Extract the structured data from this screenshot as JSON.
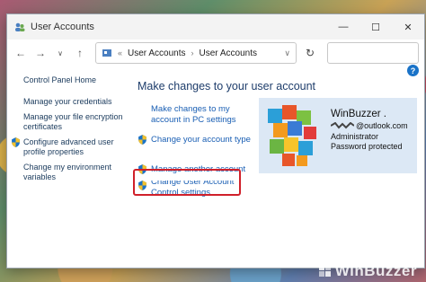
{
  "window": {
    "title": "User Accounts"
  },
  "address": {
    "overflow": "«",
    "crumbs": [
      "User Accounts",
      "User Accounts"
    ]
  },
  "left_nav": {
    "home": "Control Panel Home",
    "items": [
      "Manage your credentials",
      "Manage your file encryption certificates",
      "Configure advanced user profile properties",
      "Change my environment variables"
    ]
  },
  "main": {
    "heading": "Make changes to your user account",
    "tasks": [
      "Make changes to my account in PC settings",
      "Change your account type",
      "Manage another account",
      "Change User Account Control settings"
    ]
  },
  "account": {
    "name": "WinBuzzer .",
    "email": "@outlook.com",
    "role": "Administrator",
    "status": "Password protected"
  },
  "watermark": "WinBuzzer",
  "colors": {
    "highlight": "#d0202a",
    "link": "#1a5fb4",
    "card_bg": "#dce8f5"
  }
}
